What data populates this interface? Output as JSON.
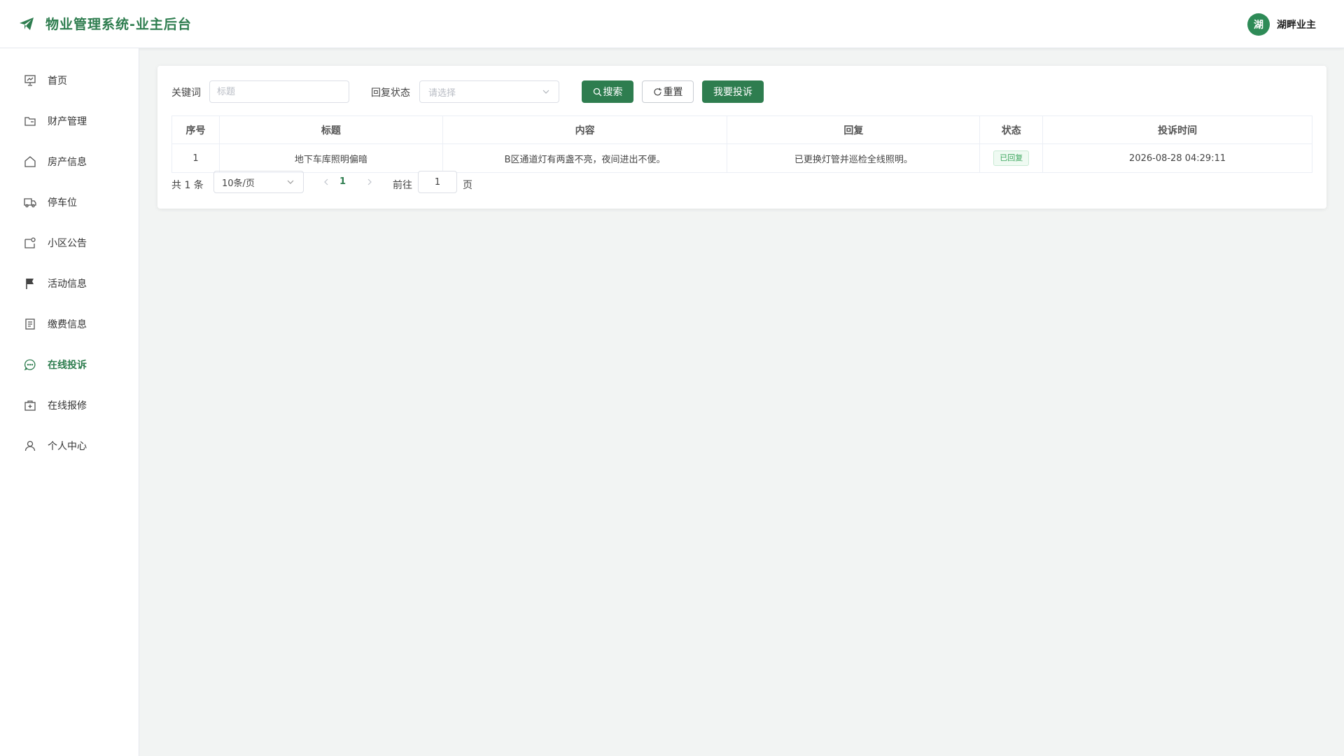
{
  "header": {
    "title": "物业管理系统-业主后台",
    "avatar_text": "湖",
    "username": "湖畔业主"
  },
  "sidebar": {
    "items": [
      {
        "label": "首页",
        "icon": "home-chart-icon"
      },
      {
        "label": "财产管理",
        "icon": "folder-icon"
      },
      {
        "label": "房产信息",
        "icon": "house-icon"
      },
      {
        "label": "停车位",
        "icon": "truck-icon"
      },
      {
        "label": "小区公告",
        "icon": "notice-icon"
      },
      {
        "label": "活动信息",
        "icon": "flag-icon"
      },
      {
        "label": "缴费信息",
        "icon": "document-icon"
      },
      {
        "label": "在线投诉",
        "icon": "chat-icon"
      },
      {
        "label": "在线报修",
        "icon": "toolbox-icon"
      },
      {
        "label": "个人中心",
        "icon": "user-icon"
      }
    ],
    "active_index": 7
  },
  "filter": {
    "keyword_label": "关键词",
    "keyword_placeholder": "标题",
    "keyword_value": "",
    "status_label": "回复状态",
    "status_placeholder": "请选择",
    "search_label": "搜索",
    "reset_label": "重置",
    "complain_label": "我要投诉"
  },
  "table": {
    "headers": [
      "序号",
      "标题",
      "内容",
      "回复",
      "状态",
      "投诉时间"
    ],
    "rows": [
      {
        "index": "1",
        "title": "地下车库照明偏暗",
        "content": "B区通道灯有两盏不亮，夜间进出不便。",
        "reply": "已更换灯管并巡检全线照明。",
        "status": "已回复",
        "time": "2026-08-28 04:29:11"
      }
    ]
  },
  "pagination": {
    "total_text": "共 1 条",
    "page_size": "10条/页",
    "current_page": "1",
    "goto_label": "前往",
    "goto_value": "1",
    "page_suffix": "页"
  },
  "colors": {
    "primary": "#2e7d4f",
    "background": "#f2f4f3",
    "tag_text": "#3aa55c"
  }
}
